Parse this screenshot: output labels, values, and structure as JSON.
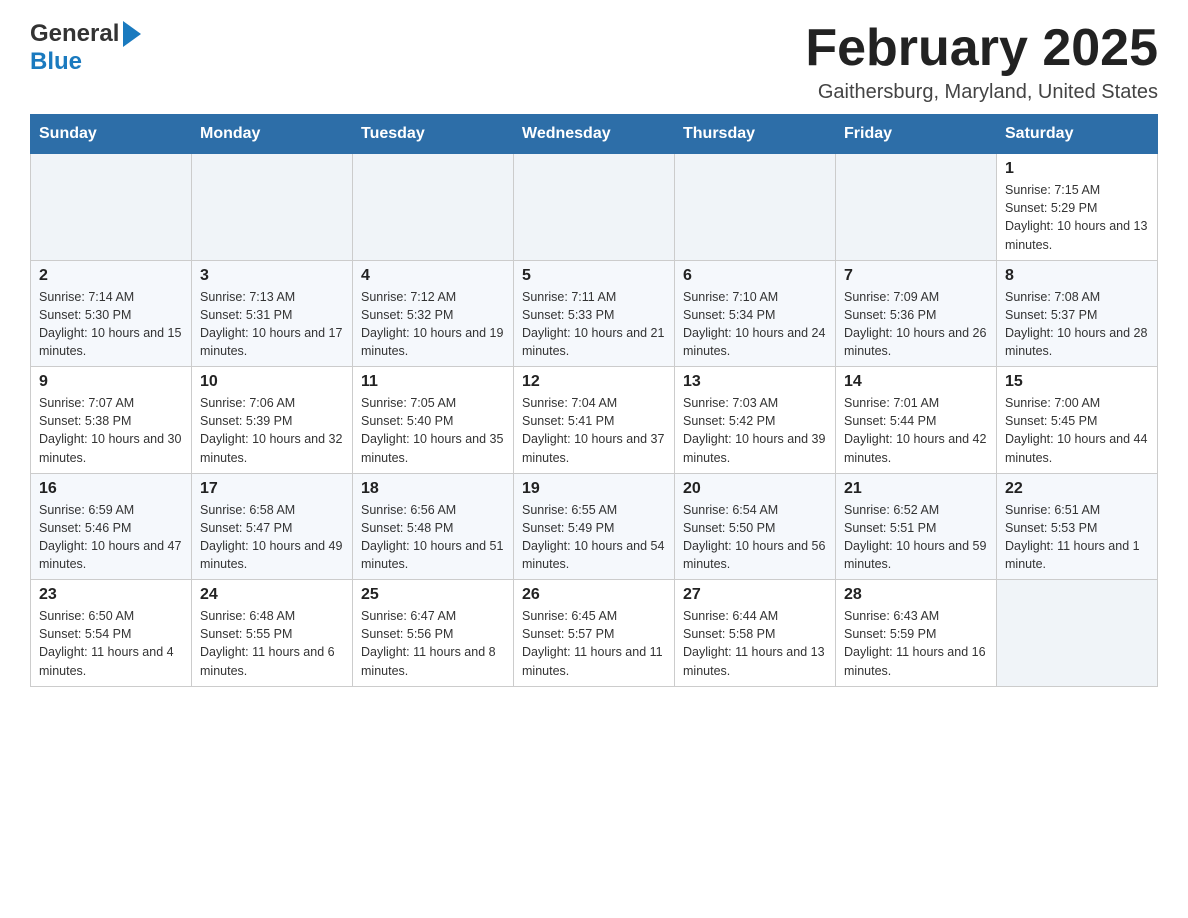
{
  "header": {
    "logo": {
      "general": "General",
      "blue": "Blue"
    },
    "title": "February 2025",
    "location": "Gaithersburg, Maryland, United States"
  },
  "weekdays": [
    "Sunday",
    "Monday",
    "Tuesday",
    "Wednesday",
    "Thursday",
    "Friday",
    "Saturday"
  ],
  "weeks": [
    [
      {
        "day": "",
        "info": ""
      },
      {
        "day": "",
        "info": ""
      },
      {
        "day": "",
        "info": ""
      },
      {
        "day": "",
        "info": ""
      },
      {
        "day": "",
        "info": ""
      },
      {
        "day": "",
        "info": ""
      },
      {
        "day": "1",
        "info": "Sunrise: 7:15 AM\nSunset: 5:29 PM\nDaylight: 10 hours and 13 minutes."
      }
    ],
    [
      {
        "day": "2",
        "info": "Sunrise: 7:14 AM\nSunset: 5:30 PM\nDaylight: 10 hours and 15 minutes."
      },
      {
        "day": "3",
        "info": "Sunrise: 7:13 AM\nSunset: 5:31 PM\nDaylight: 10 hours and 17 minutes."
      },
      {
        "day": "4",
        "info": "Sunrise: 7:12 AM\nSunset: 5:32 PM\nDaylight: 10 hours and 19 minutes."
      },
      {
        "day": "5",
        "info": "Sunrise: 7:11 AM\nSunset: 5:33 PM\nDaylight: 10 hours and 21 minutes."
      },
      {
        "day": "6",
        "info": "Sunrise: 7:10 AM\nSunset: 5:34 PM\nDaylight: 10 hours and 24 minutes."
      },
      {
        "day": "7",
        "info": "Sunrise: 7:09 AM\nSunset: 5:36 PM\nDaylight: 10 hours and 26 minutes."
      },
      {
        "day": "8",
        "info": "Sunrise: 7:08 AM\nSunset: 5:37 PM\nDaylight: 10 hours and 28 minutes."
      }
    ],
    [
      {
        "day": "9",
        "info": "Sunrise: 7:07 AM\nSunset: 5:38 PM\nDaylight: 10 hours and 30 minutes."
      },
      {
        "day": "10",
        "info": "Sunrise: 7:06 AM\nSunset: 5:39 PM\nDaylight: 10 hours and 32 minutes."
      },
      {
        "day": "11",
        "info": "Sunrise: 7:05 AM\nSunset: 5:40 PM\nDaylight: 10 hours and 35 minutes."
      },
      {
        "day": "12",
        "info": "Sunrise: 7:04 AM\nSunset: 5:41 PM\nDaylight: 10 hours and 37 minutes."
      },
      {
        "day": "13",
        "info": "Sunrise: 7:03 AM\nSunset: 5:42 PM\nDaylight: 10 hours and 39 minutes."
      },
      {
        "day": "14",
        "info": "Sunrise: 7:01 AM\nSunset: 5:44 PM\nDaylight: 10 hours and 42 minutes."
      },
      {
        "day": "15",
        "info": "Sunrise: 7:00 AM\nSunset: 5:45 PM\nDaylight: 10 hours and 44 minutes."
      }
    ],
    [
      {
        "day": "16",
        "info": "Sunrise: 6:59 AM\nSunset: 5:46 PM\nDaylight: 10 hours and 47 minutes."
      },
      {
        "day": "17",
        "info": "Sunrise: 6:58 AM\nSunset: 5:47 PM\nDaylight: 10 hours and 49 minutes."
      },
      {
        "day": "18",
        "info": "Sunrise: 6:56 AM\nSunset: 5:48 PM\nDaylight: 10 hours and 51 minutes."
      },
      {
        "day": "19",
        "info": "Sunrise: 6:55 AM\nSunset: 5:49 PM\nDaylight: 10 hours and 54 minutes."
      },
      {
        "day": "20",
        "info": "Sunrise: 6:54 AM\nSunset: 5:50 PM\nDaylight: 10 hours and 56 minutes."
      },
      {
        "day": "21",
        "info": "Sunrise: 6:52 AM\nSunset: 5:51 PM\nDaylight: 10 hours and 59 minutes."
      },
      {
        "day": "22",
        "info": "Sunrise: 6:51 AM\nSunset: 5:53 PM\nDaylight: 11 hours and 1 minute."
      }
    ],
    [
      {
        "day": "23",
        "info": "Sunrise: 6:50 AM\nSunset: 5:54 PM\nDaylight: 11 hours and 4 minutes."
      },
      {
        "day": "24",
        "info": "Sunrise: 6:48 AM\nSunset: 5:55 PM\nDaylight: 11 hours and 6 minutes."
      },
      {
        "day": "25",
        "info": "Sunrise: 6:47 AM\nSunset: 5:56 PM\nDaylight: 11 hours and 8 minutes."
      },
      {
        "day": "26",
        "info": "Sunrise: 6:45 AM\nSunset: 5:57 PM\nDaylight: 11 hours and 11 minutes."
      },
      {
        "day": "27",
        "info": "Sunrise: 6:44 AM\nSunset: 5:58 PM\nDaylight: 11 hours and 13 minutes."
      },
      {
        "day": "28",
        "info": "Sunrise: 6:43 AM\nSunset: 5:59 PM\nDaylight: 11 hours and 16 minutes."
      },
      {
        "day": "",
        "info": ""
      }
    ]
  ]
}
